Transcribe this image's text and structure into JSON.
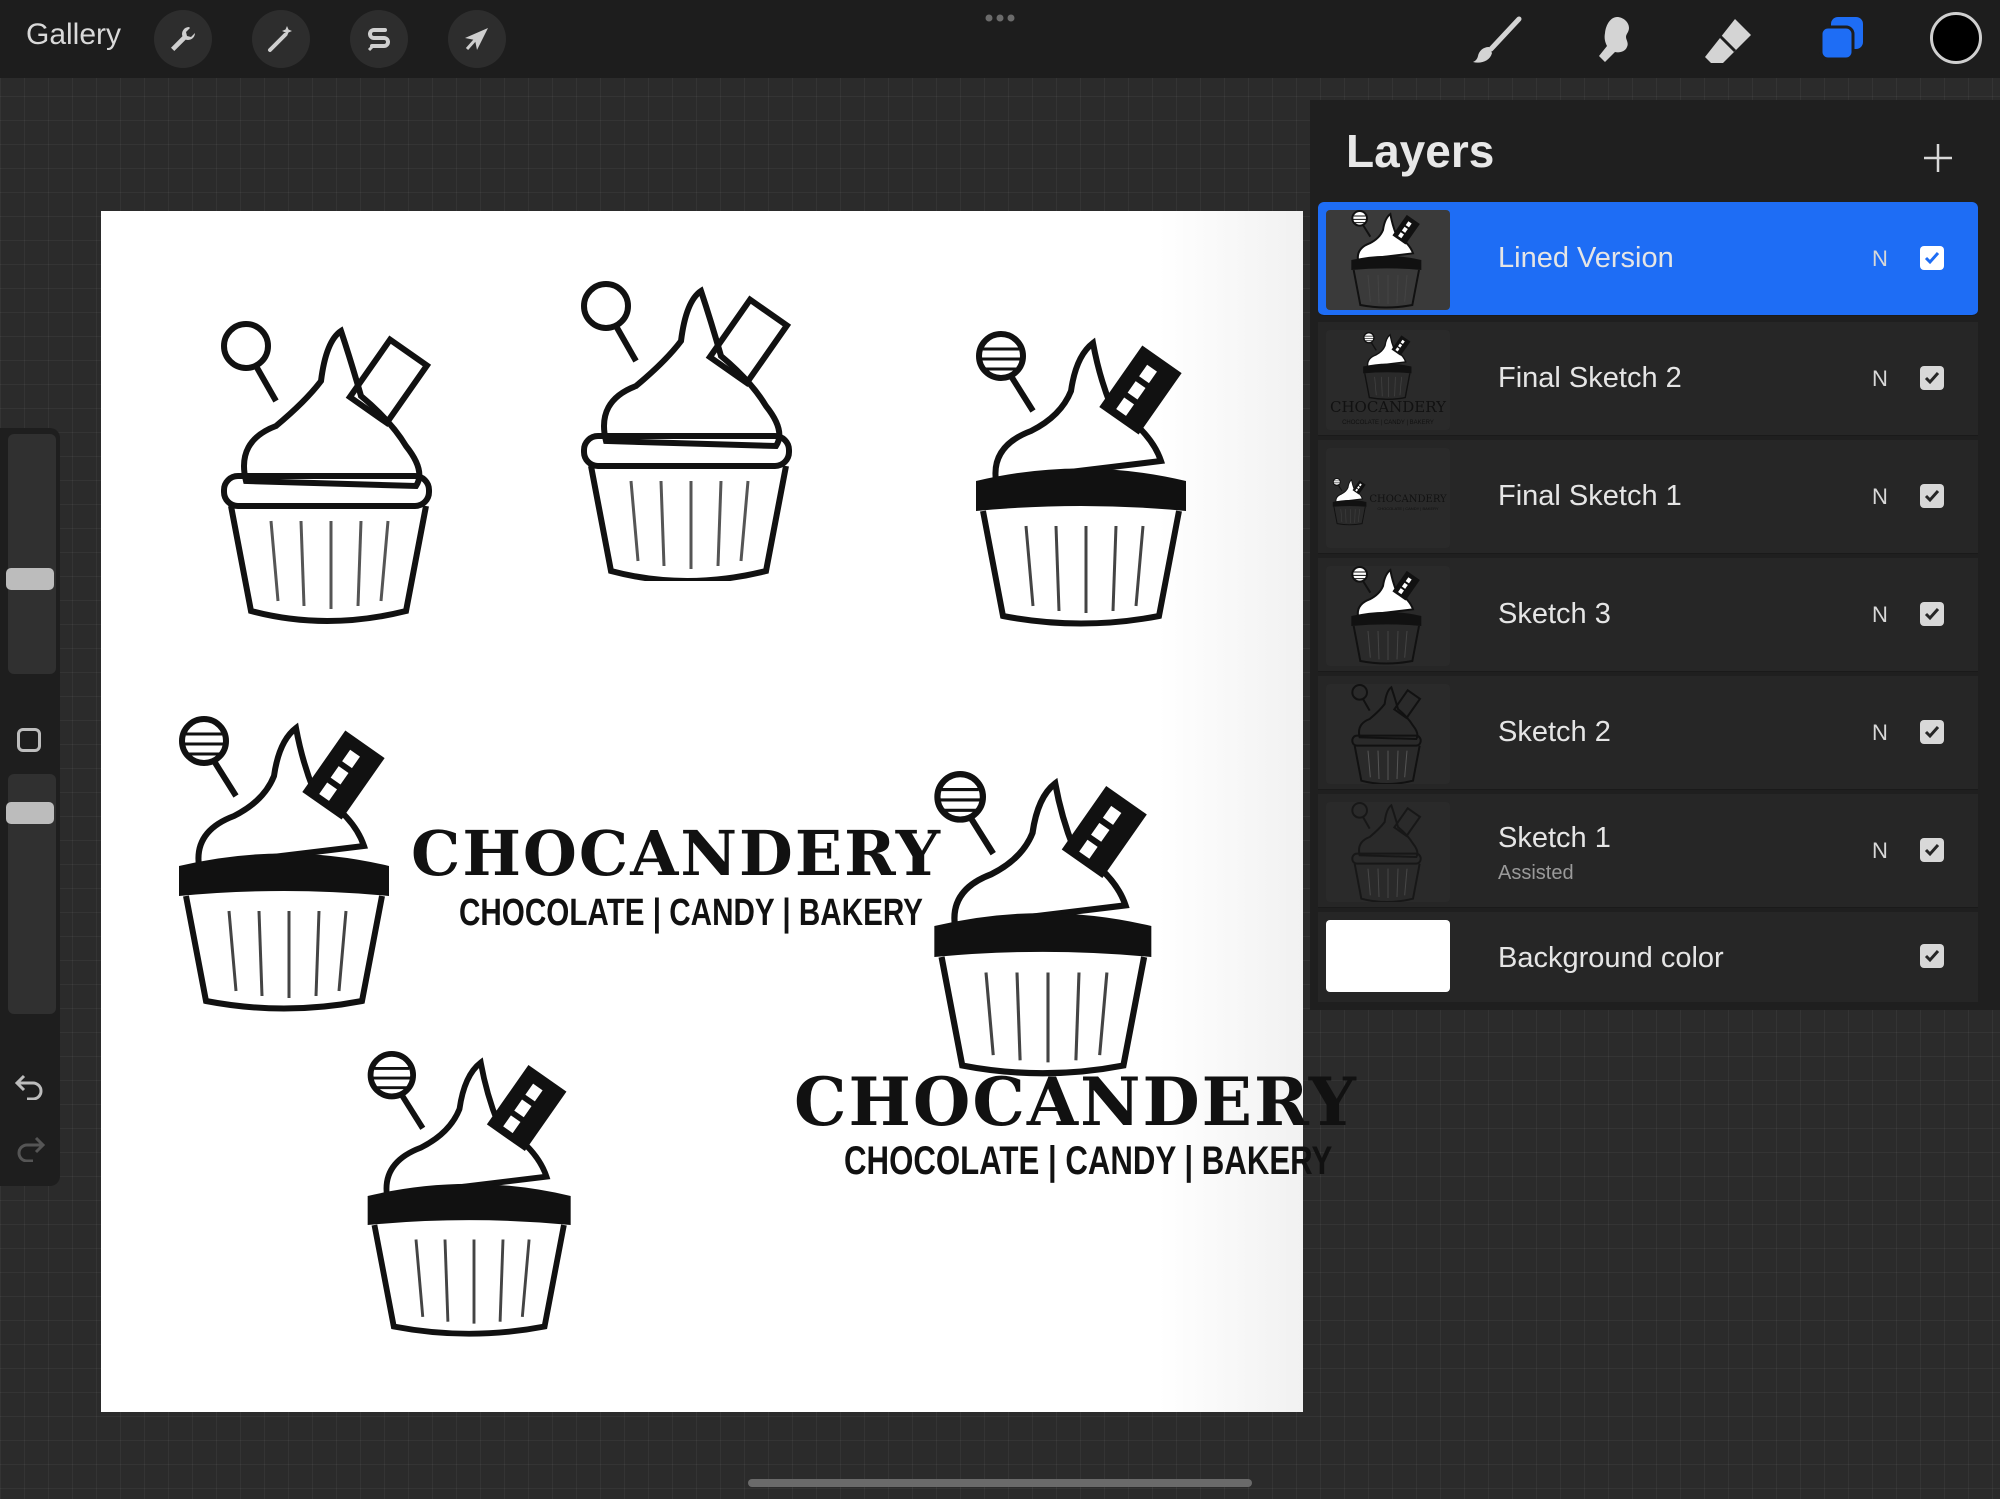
{
  "topbar": {
    "gallery_label": "Gallery",
    "tools_left": [
      "wrench-icon",
      "magic-wand-icon",
      "selection-s-icon",
      "arrow-transform-icon"
    ],
    "tools_right": [
      "brush-icon",
      "smudge-icon",
      "eraser-icon",
      "layers-icon"
    ],
    "active_tool": "layers-icon",
    "current_color": "#000000"
  },
  "canvas": {
    "logo1": {
      "title": "CHOCANDERY",
      "subtitle": "CHOCOLATE | CANDY | BAKERY"
    },
    "logo2": {
      "title": "CHOCANDERY",
      "subtitle": "CHOCOLATE | CANDY | BAKERY"
    }
  },
  "layers_panel": {
    "title": "Layers",
    "add_icon": "plus-icon",
    "items": [
      {
        "name": "Lined Version",
        "sub": "",
        "blend": "N",
        "visible": true,
        "selected": true
      },
      {
        "name": "Final Sketch 2",
        "sub": "",
        "blend": "N",
        "visible": true,
        "selected": false
      },
      {
        "name": "Final Sketch 1",
        "sub": "",
        "blend": "N",
        "visible": true,
        "selected": false
      },
      {
        "name": "Sketch 3",
        "sub": "",
        "blend": "N",
        "visible": true,
        "selected": false
      },
      {
        "name": "Sketch 2",
        "sub": "",
        "blend": "N",
        "visible": true,
        "selected": false
      },
      {
        "name": "Sketch 1",
        "sub": "Assisted",
        "blend": "N",
        "visible": true,
        "selected": false
      },
      {
        "name": "Background color",
        "sub": "",
        "blend": "",
        "visible": true,
        "selected": false
      }
    ],
    "thumb_logo_text": "CHOCANDERY",
    "thumb_logo_sub": "CHOCOLATE | CANDY | BAKERY"
  },
  "colors": {
    "accent": "#1e6df5",
    "background": "#2b2b2b",
    "toolbar": "#1d1d1d"
  }
}
